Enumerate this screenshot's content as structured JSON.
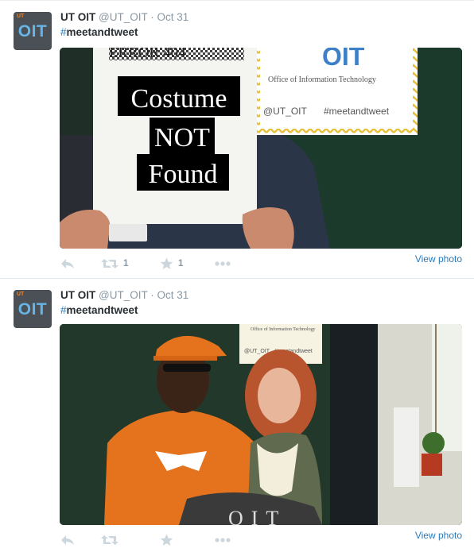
{
  "tweets": [
    {
      "avatar": {
        "brand_small": "UT",
        "brand_large": "OIT"
      },
      "fullname": "UT OIT",
      "username": "@UT_OIT",
      "separator": "·",
      "timestamp": "Oct 31",
      "hash_symbol": "#",
      "hashtag_word": "meetandtweet",
      "photo": {
        "sign_line1": "ERROR 404",
        "sign_line2": "Costume",
        "sign_line3": "NOT",
        "sign_line4": "Found",
        "banner_logo": "OIT",
        "banner_subtitle": "Office of Information Technology",
        "banner_handle": "@UT_OIT",
        "banner_tag": "#meetandtweet"
      },
      "retweet_count": "1",
      "favorite_count": "1",
      "view_photo": "View photo"
    },
    {
      "avatar": {
        "brand_small": "UT",
        "brand_large": "OIT"
      },
      "fullname": "UT OIT",
      "username": "@UT_OIT",
      "separator": "·",
      "timestamp": "Oct 31",
      "hash_symbol": "#",
      "hashtag_word": "meetandtweet",
      "photo": {
        "banner_subtitle": "Office of Information Technology",
        "banner_handle": "@UT_OIT",
        "banner_tag": "#meetandtweet",
        "tombstone_text": "OIT"
      },
      "view_photo": "View photo"
    }
  ],
  "colors": {
    "link": "#2b7bb9",
    "secondary_text": "#8899a6",
    "icon": "#ccd6dd",
    "divider": "#e1e8ed",
    "ut_orange": "#f58220",
    "oit_blue": "#66b5e6"
  },
  "icons": [
    "reply-icon",
    "retweet-icon",
    "favorite-star-icon",
    "more-dots-icon"
  ]
}
